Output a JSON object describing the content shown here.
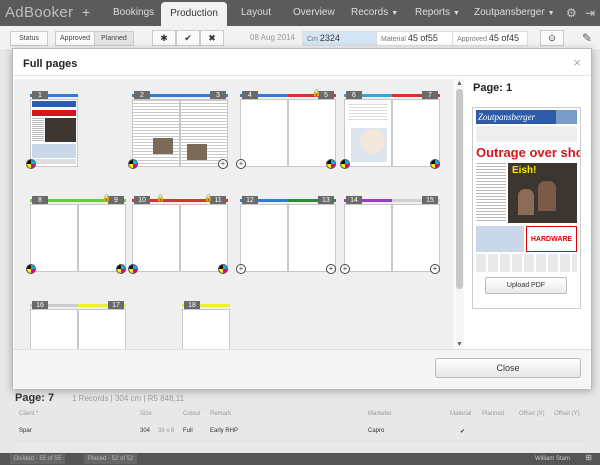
{
  "app": {
    "logo": "AdBooker",
    "plus": "+",
    "nav": [
      {
        "label": "Bookings",
        "caret": ""
      },
      {
        "label": "Production",
        "caret": ""
      },
      {
        "label": "Layout",
        "caret": ""
      },
      {
        "label": "Overview",
        "caret": ""
      },
      {
        "label": "Records",
        "caret": "▼"
      },
      {
        "label": "Reports",
        "caret": "▼"
      },
      {
        "label": "Zoutpansberger",
        "caret": "▼"
      }
    ],
    "nav_icons": [
      "⚙",
      "⇥"
    ]
  },
  "subbar": {
    "filters": [
      "Status",
      "Approved",
      "Planned"
    ],
    "actions": [
      "✱",
      "✔",
      "✖"
    ],
    "date": "08 Aug 2014",
    "stats": [
      {
        "label": "Cm",
        "value": "2324"
      },
      {
        "label": "Material",
        "value": "45 of55"
      },
      {
        "label": "Approved",
        "value": "45 of45"
      }
    ],
    "right_icons": [
      "⊙",
      "✎"
    ]
  },
  "modal": {
    "title": "Full pages",
    "close_x": "×",
    "page_numbers": [
      "1",
      "2",
      "3",
      "4",
      "5",
      "6",
      "7",
      "8",
      "9",
      "10",
      "11",
      "12",
      "13",
      "14",
      "15",
      "16",
      "17",
      "18"
    ],
    "bar_colors": [
      "#2e7ed8",
      "#2e7ed8",
      "#2e7ed8",
      "#2e7ed8",
      "#d93030",
      "#3aa3d8",
      "#d93030",
      "#66cc33",
      "#66cc33",
      "#d93030",
      "#d93030",
      "#2e7ed8",
      "#2e8b3a",
      "#9b3dc4",
      "#d0d0d0",
      "#cccccc",
      "#eeee33",
      "#eeee33"
    ],
    "right_panel": {
      "title": "Page: 1",
      "newspaper_masthead": "Zoutpansberger",
      "newspaper_headline": "Outrage over show",
      "newspaper_eish": "Eish!",
      "newspaper_ad": "HARDWARE",
      "upload_button": "Upload PDF"
    },
    "close_button": "Close"
  },
  "records": {
    "title": "Page: 7",
    "info": "1 Records | 304 cm | R5 848,11",
    "columns": [
      "Client *",
      "Size",
      "Colour",
      "Remark",
      "Marketer",
      "Material",
      "Planned",
      "Offset (X)",
      "Offset (Y)"
    ],
    "rows": [
      {
        "client": "Spar",
        "size": "304",
        "size_detail": "38 x 8",
        "colour": "Full",
        "remark": "Early RHP",
        "marketer": "Capro",
        "material": "✔",
        "planned": "",
        "offset_x": "",
        "offset_y": ""
      }
    ]
  },
  "footer": {
    "items": [
      "Divided - 55 of 55",
      "Placed - 52 of 52"
    ],
    "user": "William Stam",
    "icon": "⊞"
  }
}
